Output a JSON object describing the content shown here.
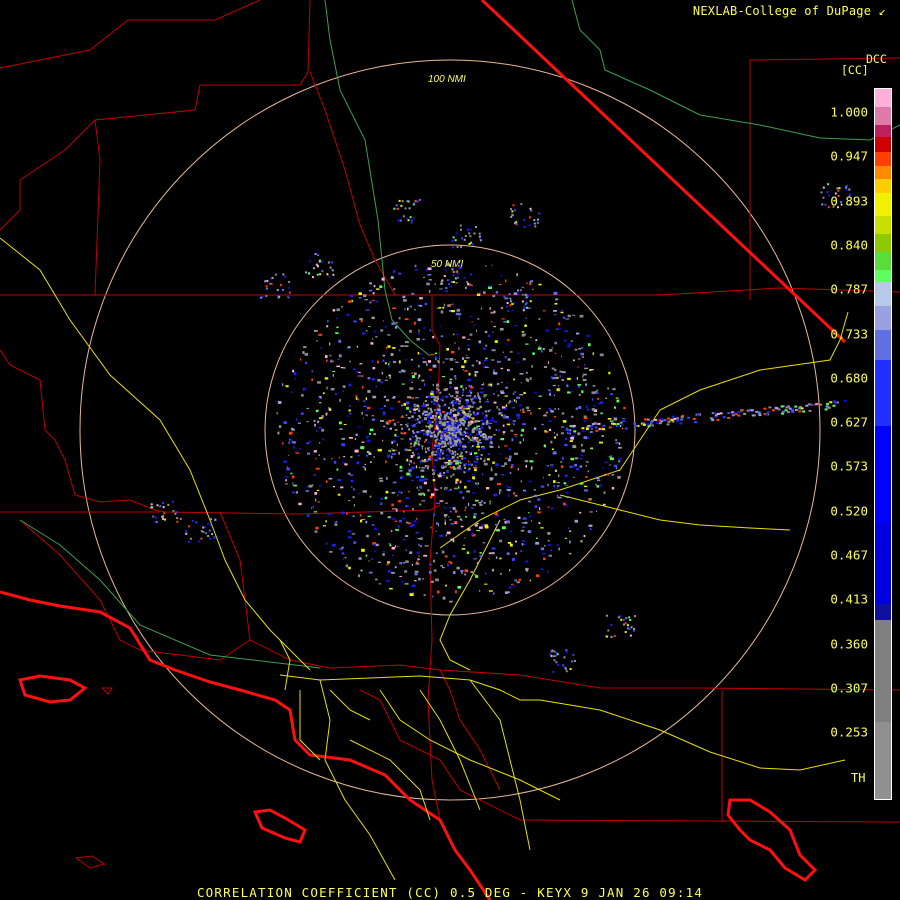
{
  "header": {
    "credit": "NEXLAB-College of DuPage",
    "site_code": "DCC",
    "units": "[CC]"
  },
  "rings": {
    "outer_label": "100 NMI",
    "inner_label": "50 NMI"
  },
  "colorbar": {
    "ticks": [
      "1.000",
      "0.947",
      "0.893",
      "0.840",
      "0.787",
      "0.733",
      "0.680",
      "0.627",
      "0.573",
      "0.520",
      "0.467",
      "0.413",
      "0.360",
      "0.307",
      "0.253"
    ],
    "bottom_label": "TH",
    "stops": [
      {
        "value": 1.0,
        "color": "#ffb0d8"
      },
      {
        "value": 0.98,
        "color": "#e07aa8"
      },
      {
        "value": 0.96,
        "color": "#c02060"
      },
      {
        "value": 0.947,
        "color": "#d00000"
      },
      {
        "value": 0.93,
        "color": "#ff4000"
      },
      {
        "value": 0.915,
        "color": "#ff8a00"
      },
      {
        "value": 0.9,
        "color": "#ffcc00"
      },
      {
        "value": 0.885,
        "color": "#f0f000"
      },
      {
        "value": 0.86,
        "color": "#c8e000"
      },
      {
        "value": 0.84,
        "color": "#8ec800"
      },
      {
        "value": 0.82,
        "color": "#5adc3a"
      },
      {
        "value": 0.8,
        "color": "#60ff60"
      },
      {
        "value": 0.787,
        "color": "#b8c8e8"
      },
      {
        "value": 0.76,
        "color": "#9aa0e0"
      },
      {
        "value": 0.733,
        "color": "#6070e0"
      },
      {
        "value": 0.7,
        "color": "#2030ff"
      },
      {
        "value": 0.627,
        "color": "#0000ff"
      },
      {
        "value": 0.52,
        "color": "#0000e0"
      },
      {
        "value": 0.43,
        "color": "#1010a0"
      },
      {
        "value": 0.413,
        "color": "#808080"
      },
      {
        "value": 0.3,
        "color": "#909090"
      },
      {
        "value": 0.23,
        "color": "#909090"
      },
      {
        "value": 0.215,
        "color": "#000000"
      }
    ]
  },
  "footer": {
    "product_title": "CORRELATION COEFFICIENT (CC) 0.5 DEG - KEYX 9 JAN 26 09:14"
  }
}
